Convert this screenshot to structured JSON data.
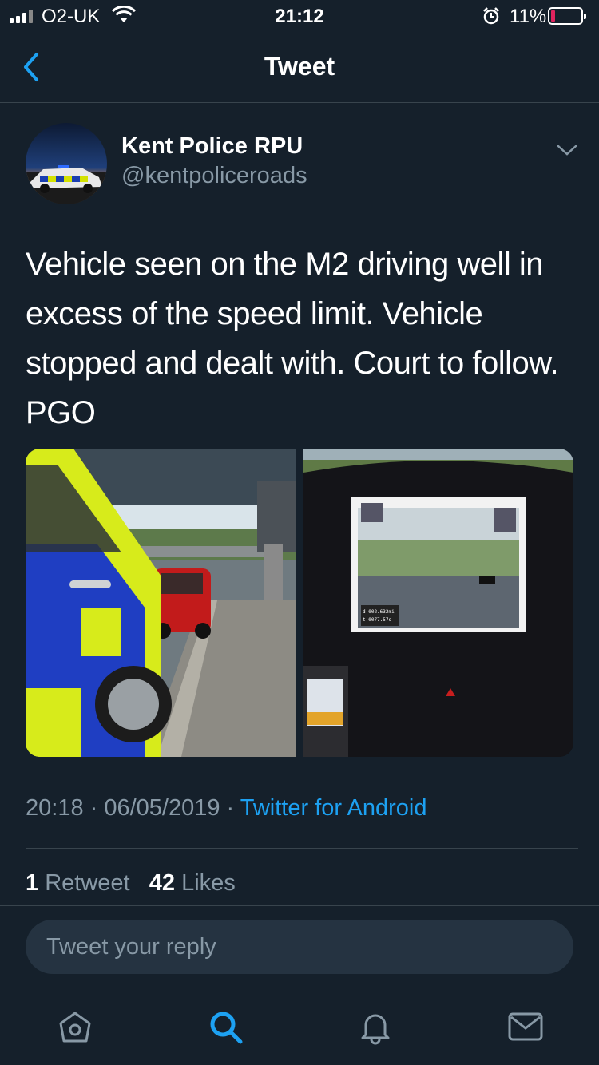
{
  "status_bar": {
    "carrier": "O2-UK",
    "time": "21:12",
    "battery": "11%"
  },
  "nav": {
    "title": "Tweet",
    "back_icon": "chevron-left-icon"
  },
  "tweet": {
    "author_name": "Kent Police RPU",
    "author_handle": "@kentpoliceroads",
    "text": "Vehicle seen on the M2 driving well in excess of the speed limit. Vehicle stopped and dealt with. Court to follow. PGO",
    "timestamp": "20:18 · 06/05/2019 · ",
    "source": "Twitter for Android",
    "retweets_count": "1",
    "retweets_label": "Retweet",
    "likes_count": "42",
    "likes_label": "Likes"
  },
  "reply": {
    "placeholder": "Tweet your reply"
  },
  "tab_bar": {
    "items": [
      "home-icon",
      "search-icon",
      "notifications-icon",
      "messages-icon"
    ],
    "active": "search-icon"
  },
  "colors": {
    "background": "#15202b",
    "accent": "#1da1f2",
    "secondary_text": "#8899a6",
    "divider": "#38444d"
  }
}
